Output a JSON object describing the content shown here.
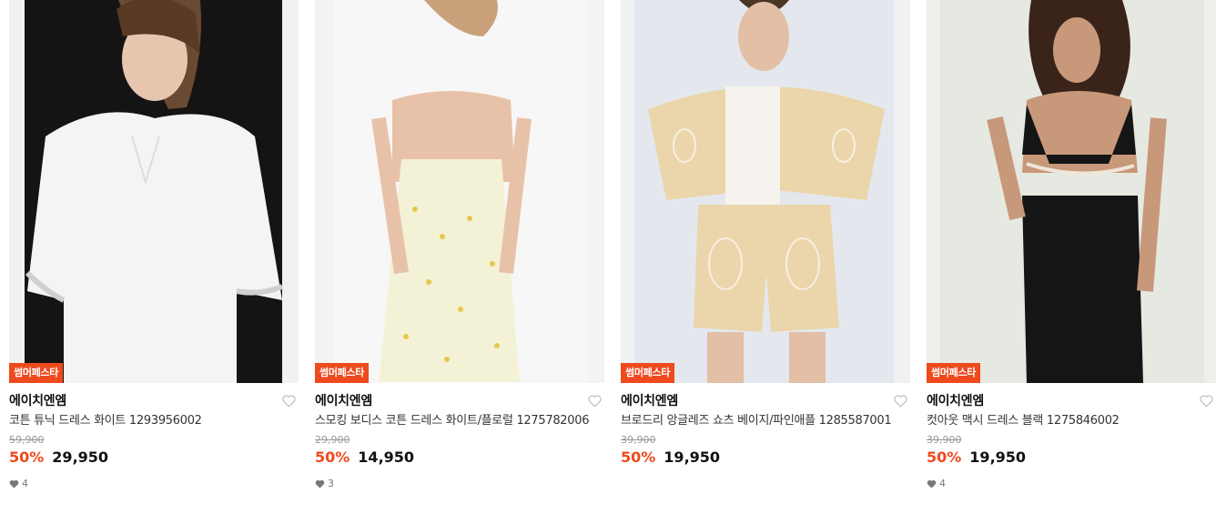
{
  "colors": {
    "accent": "#ee4a1d",
    "badge_bg": "#ee4a1d"
  },
  "products": [
    {
      "badge": "썸머페스타",
      "brand": "에이치엔엠",
      "name": "코튼 튜닉 드레스 화이트 1293956002",
      "original_price": "59,900",
      "discount": "50%",
      "price": "29,950",
      "likes": "4"
    },
    {
      "badge": "썸머페스타",
      "brand": "에이치엔엠",
      "name": "스모킹 보디스 코튼 드레스 화이트/플로럴 1275782006",
      "original_price": "29,900",
      "discount": "50%",
      "price": "14,950",
      "likes": "3"
    },
    {
      "badge": "썸머페스타",
      "brand": "에이치엔엠",
      "name": "브로드리 앙글레즈 쇼츠 베이지/파인애플 1285587001",
      "original_price": "39,900",
      "discount": "50%",
      "price": "19,950",
      "likes": ""
    },
    {
      "badge": "썸머페스타",
      "brand": "에이치엔엠",
      "name": "컷아웃 맥시 드레스 블랙 1275846002",
      "original_price": "39,900",
      "discount": "50%",
      "price": "19,950",
      "likes": "4"
    }
  ]
}
